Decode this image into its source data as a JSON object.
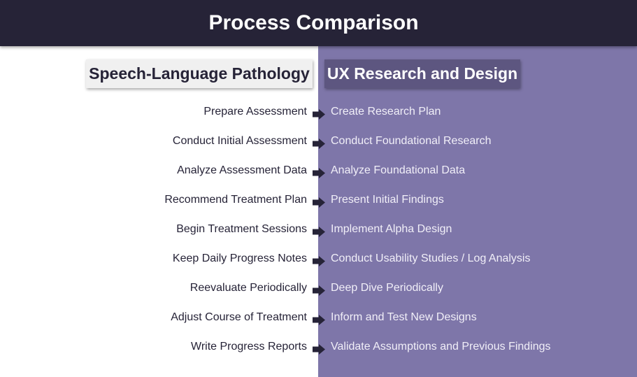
{
  "title": "Process Comparison",
  "columns": {
    "left": {
      "heading": "Speech-Language Pathology"
    },
    "right": {
      "heading": "UX Research and Design"
    }
  },
  "colors": {
    "title_bar": "#262337",
    "right_panel": "#7e76a9",
    "left_header_bg": "#f0f0f0",
    "right_header_bg": "#5d5680",
    "arrow": "#262337"
  },
  "connector_icon": "right-arrow-icon",
  "steps": [
    {
      "left": "Prepare Assessment",
      "right": "Create Research Plan"
    },
    {
      "left": "Conduct Initial Assessment",
      "right": "Conduct Foundational Research"
    },
    {
      "left": "Analyze Assessment Data",
      "right": "Analyze Foundational Data"
    },
    {
      "left": "Recommend Treatment Plan",
      "right": "Present Initial Findings"
    },
    {
      "left": "Begin Treatment Sessions",
      "right": "Implement Alpha Design"
    },
    {
      "left": "Keep Daily Progress Notes",
      "right": "Conduct Usability Studies / Log Analysis"
    },
    {
      "left": "Reevaluate Periodically",
      "right": "Deep Dive Periodically"
    },
    {
      "left": "Adjust Course of Treatment",
      "right": "Inform and Test New Designs"
    },
    {
      "left": "Write Progress Reports",
      "right": "Validate Assumptions and Previous Findings"
    }
  ]
}
